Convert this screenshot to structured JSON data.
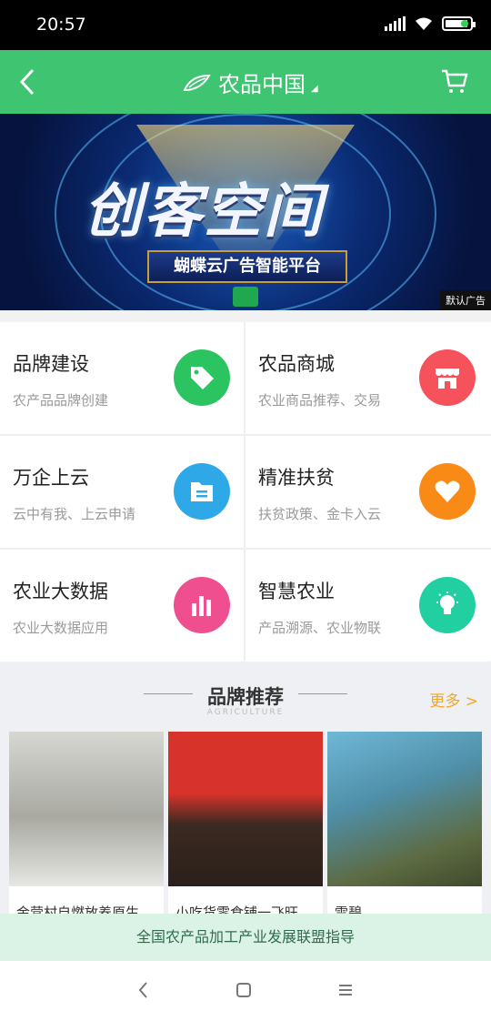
{
  "status": {
    "time": "20:57"
  },
  "header": {
    "title": "农品中国",
    "caret": "◢"
  },
  "banner": {
    "headline": "创客空间",
    "subtitle": "蝴蝶云广告智能平台",
    "ad_tag": "默认广告"
  },
  "grid": [
    {
      "name": "品牌建设",
      "desc": "农产品品牌创建",
      "color": "#2cc461",
      "icon": "tag-icon"
    },
    {
      "name": "农品商城",
      "desc": "农业商品推荐、交易",
      "color": "#f5525c",
      "icon": "store-icon"
    },
    {
      "name": "万企上云",
      "desc": "云中有我、上云申请",
      "color": "#2fa8e8",
      "icon": "folder-icon"
    },
    {
      "name": "精准扶贫",
      "desc": "扶贫政策、金卡入云",
      "color": "#f98a15",
      "icon": "heart-icon"
    },
    {
      "name": "农业大数据",
      "desc": "农业大数据应用",
      "color": "#f04f8f",
      "icon": "bar-chart-icon"
    },
    {
      "name": "智慧农业",
      "desc": "产品溯源、农业物联",
      "color": "#22cfa0",
      "icon": "lightbulb-icon"
    }
  ],
  "section": {
    "title": "品牌推荐",
    "subtitle": "AGRICULTURE",
    "more": "更多 >"
  },
  "products": [
    {
      "caption": "金营村自燃放养原生"
    },
    {
      "caption": "小吃货零食铺一飞旺"
    },
    {
      "caption": "雪碧"
    }
  ],
  "footer": {
    "text": "全国农产品加工产业发展联盟指导"
  }
}
